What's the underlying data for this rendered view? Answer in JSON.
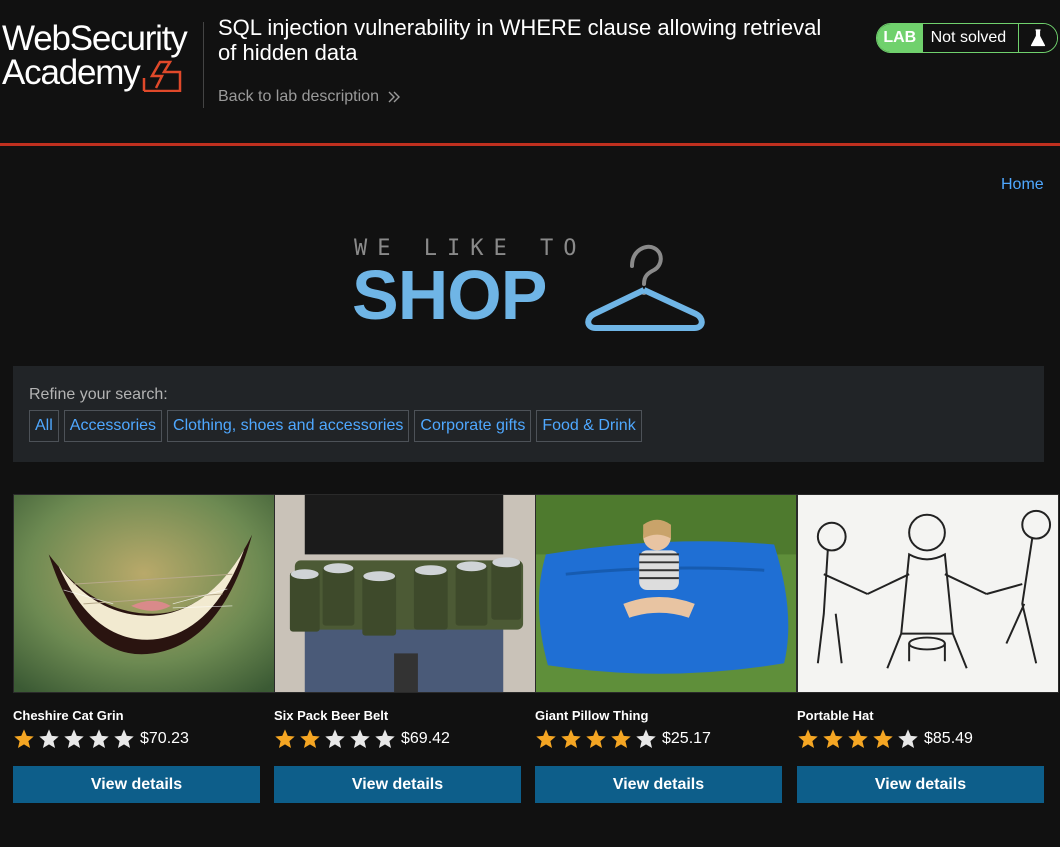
{
  "header": {
    "logo_line1": "WebSecurity",
    "logo_line2": "Academy",
    "lab_title": "SQL injection vulnerability in WHERE clause allowing retrieval of hidden data",
    "back_link": "Back to lab description",
    "lab_badge": "LAB",
    "lab_status": "Not solved",
    "accent_color": "#c0301f",
    "status_color": "#70d16d"
  },
  "nav": {
    "home": "Home"
  },
  "shop_logo": {
    "tagline": "WE LIKE TO",
    "word": "SHOP",
    "color": "#6fb5e6"
  },
  "filter": {
    "title": "Refine your search:",
    "categories": [
      "All",
      "Accessories",
      "Clothing, shoes and accessories",
      "Corporate gifts",
      "Food & Drink"
    ]
  },
  "products": [
    {
      "name": "Cheshire Cat Grin",
      "rating": 1,
      "price": "$70.23",
      "button": "View details",
      "image": "cheshire-cat-grin-image"
    },
    {
      "name": "Six Pack Beer Belt",
      "rating": 2,
      "price": "$69.42",
      "button": "View details",
      "image": "beer-belt-image"
    },
    {
      "name": "Giant Pillow Thing",
      "rating": 4,
      "price": "$25.17",
      "button": "View details",
      "image": "giant-pillow-image"
    },
    {
      "name": "Portable Hat",
      "rating": 4,
      "price": "$85.49",
      "button": "View details",
      "image": "portable-hat-image"
    }
  ],
  "colors": {
    "link": "#4fa8ff",
    "button": "#0d5e8a",
    "star_on": "#f5a623",
    "star_off": "#e8e8e8"
  }
}
